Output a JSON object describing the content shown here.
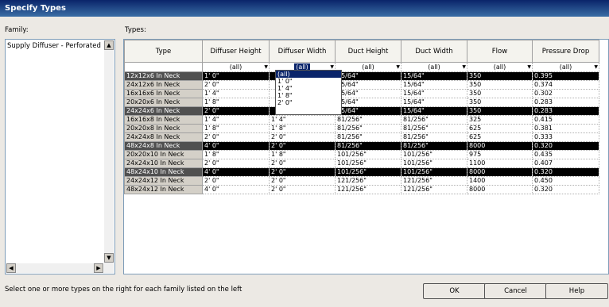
{
  "window": {
    "title": "Specify Types"
  },
  "family": {
    "label": "Family:",
    "items": [
      "Supply Diffuser - Perforated"
    ]
  },
  "types": {
    "label": "Types:",
    "columns": [
      "Type",
      "Diffuser Height",
      "Diffuser Width",
      "Duct Height",
      "Duct Width",
      "Flow",
      "Pressure Drop"
    ],
    "filter_values": [
      "(all)",
      "(all)",
      "(all)",
      "(all)",
      "(all)",
      "(all)"
    ],
    "rows": [
      {
        "type": "12x12x6 In Neck",
        "dh": "1'  0\"",
        "dw": "",
        "duh": "15/64\"",
        "duw": "15/64\"",
        "flow": "350",
        "pd": "0.395",
        "selected": true
      },
      {
        "type": "24x12x6 In Neck",
        "dh": "2'  0\"",
        "dw": "",
        "duh": "15/64\"",
        "duw": "15/64\"",
        "flow": "350",
        "pd": "0.374",
        "selected": false
      },
      {
        "type": "16x16x6 In Neck",
        "dh": "1'  4\"",
        "dw": "",
        "duh": "15/64\"",
        "duw": "15/64\"",
        "flow": "350",
        "pd": "0.302",
        "selected": false
      },
      {
        "type": "20x20x6 In Neck",
        "dh": "1'  8\"",
        "dw": "",
        "duh": "15/64\"",
        "duw": "15/64\"",
        "flow": "350",
        "pd": "0.283",
        "selected": false
      },
      {
        "type": "24x24x6 In Neck",
        "dh": "2'  0\"",
        "dw": "",
        "duh": "15/64\"",
        "duw": "15/64\"",
        "flow": "350",
        "pd": "0.283",
        "selected": true
      },
      {
        "type": "16x16x8 In Neck",
        "dh": "1'  4\"",
        "dw": "1'  4\"",
        "duh": "81/256\"",
        "duw": "81/256\"",
        "flow": "325",
        "pd": "0.415",
        "selected": false
      },
      {
        "type": "20x20x8 In Neck",
        "dh": "1'  8\"",
        "dw": "1'  8\"",
        "duh": "81/256\"",
        "duw": "81/256\"",
        "flow": "625",
        "pd": "0.381",
        "selected": false
      },
      {
        "type": "24x24x8 In Neck",
        "dh": "2'  0\"",
        "dw": "2'  0\"",
        "duh": "81/256\"",
        "duw": "81/256\"",
        "flow": "625",
        "pd": "0.333",
        "selected": false
      },
      {
        "type": "48x24x8 In Neck",
        "dh": "4'  0\"",
        "dw": "2'  0\"",
        "duh": "81/256\"",
        "duw": "81/256\"",
        "flow": "8000",
        "pd": "0.320",
        "selected": true
      },
      {
        "type": "20x20x10 In Neck",
        "dh": "1'  8\"",
        "dw": "1'  8\"",
        "duh": "101/256\"",
        "duw": "101/256\"",
        "flow": "975",
        "pd": "0.435",
        "selected": false
      },
      {
        "type": "24x24x10 In Neck",
        "dh": "2'  0\"",
        "dw": "2'  0\"",
        "duh": "101/256\"",
        "duw": "101/256\"",
        "flow": "1100",
        "pd": "0.407",
        "selected": false
      },
      {
        "type": "48x24x10 In Neck",
        "dh": "4'  0\"",
        "dw": "2'  0\"",
        "duh": "101/256\"",
        "duw": "101/256\"",
        "flow": "8000",
        "pd": "0.320",
        "selected": true
      },
      {
        "type": "24x24x12 In Neck",
        "dh": "2'  0\"",
        "dw": "2'  0\"",
        "duh": "121/256\"",
        "duw": "121/256\"",
        "flow": "1400",
        "pd": "0.450",
        "selected": false
      },
      {
        "type": "48x24x12 In Neck",
        "dh": "4'  0\"",
        "dw": "2'  0\"",
        "duh": "121/256\"",
        "duw": "121/256\"",
        "flow": "8000",
        "pd": "0.320",
        "selected": false
      }
    ]
  },
  "dropdown": {
    "options": [
      "(all)",
      "1'  0\"",
      "1'  4\"",
      "1'  8\"",
      "2'  0\""
    ]
  },
  "status_text": "Select one or more types on the right for each family listed on the left",
  "buttons": {
    "ok": "OK",
    "cancel": "Cancel",
    "help": "Help"
  },
  "icons": {
    "scroll_up": "scroll-up-icon",
    "scroll_down": "scroll-down-icon",
    "dropdown": "chevron-down-icon"
  }
}
